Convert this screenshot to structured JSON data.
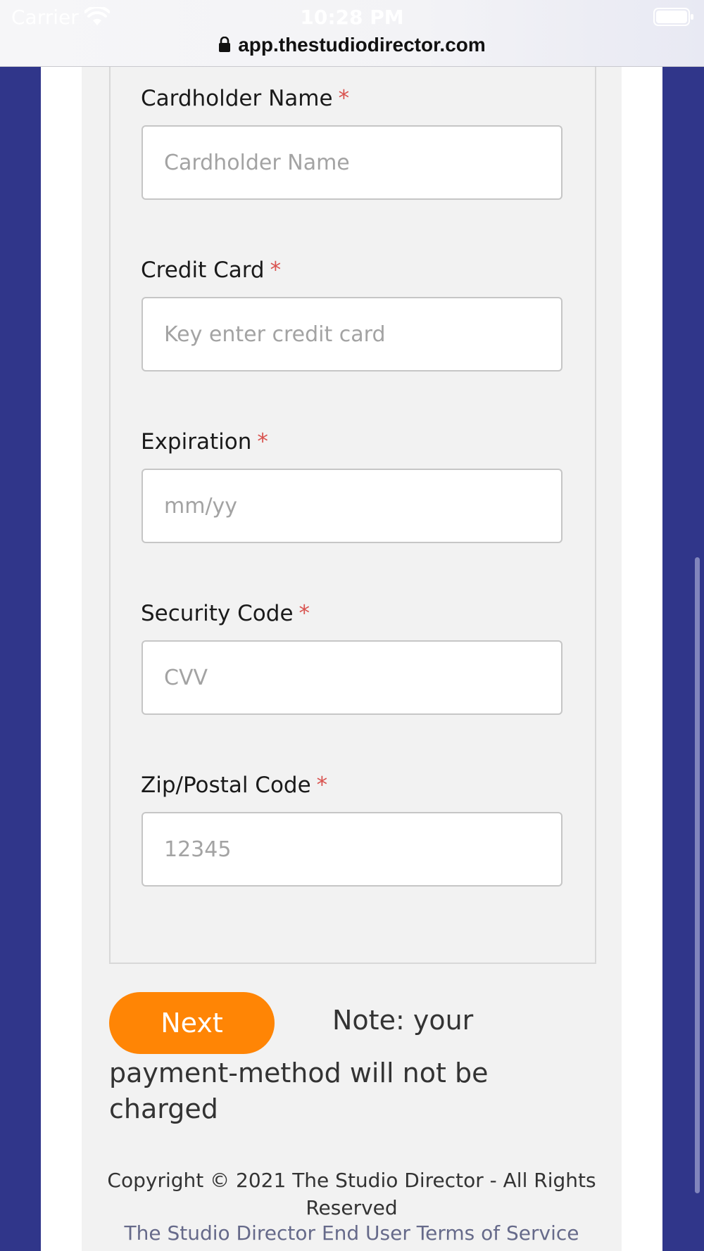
{
  "status_bar": {
    "carrier": "Carrier",
    "time": "10:28 PM",
    "url": "app.thestudiodirector.com",
    "icons": [
      "wifi-icon",
      "battery-icon",
      "lock-icon"
    ]
  },
  "form": {
    "required_marker": "*",
    "fields": [
      {
        "label": "Cardholder Name",
        "placeholder": "Cardholder Name",
        "value": ""
      },
      {
        "label": "Credit Card",
        "placeholder": "Key enter credit card",
        "value": ""
      },
      {
        "label": "Expiration",
        "placeholder": "mm/yy",
        "value": ""
      },
      {
        "label": "Security Code",
        "placeholder": "CVV",
        "value": ""
      },
      {
        "label": "Zip/Postal Code",
        "placeholder": "12345",
        "value": ""
      }
    ]
  },
  "actions": {
    "next_label": "Next",
    "note_line_1": "Note: your",
    "note_line_2": "payment-method will not be charged"
  },
  "footer": {
    "copyright": "Copyright © 2021 The Studio Director - All Rights Reserved",
    "terms_link": "The Studio Director End User Terms of Service"
  },
  "colors": {
    "page_background": "#30368a",
    "panel_background": "#f2f2f2",
    "button_orange": "#ff8505",
    "required_red": "#d9534f"
  }
}
